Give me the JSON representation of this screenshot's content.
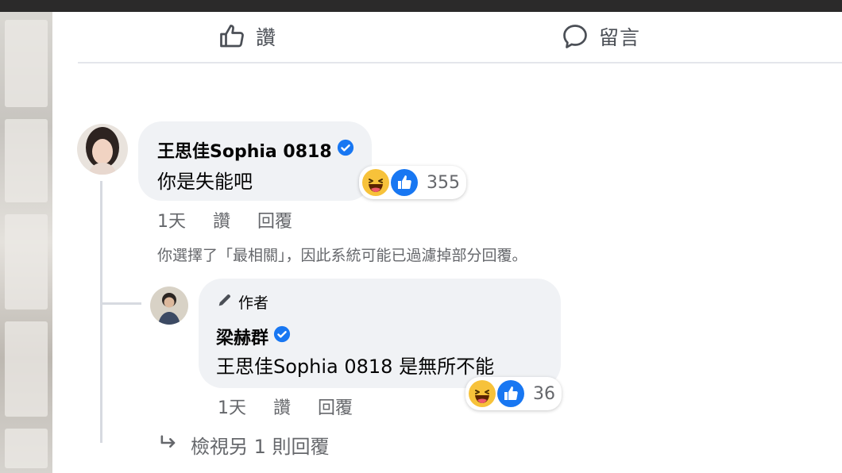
{
  "action_bar": {
    "like_label": "讚",
    "comment_label": "留言"
  },
  "comment": {
    "author": "王思佳Sophia 0818",
    "text": "你是失能吧",
    "reaction_count": "355",
    "time": "1天",
    "like_action": "讚",
    "reply_action": "回覆"
  },
  "filter_notice": "你選擇了「最相關」，因此系統可能已過濾掉部分回覆。",
  "reply": {
    "badge": "作者",
    "author": "梁赫群",
    "text": "王思佳Sophia 0818 是無所不能",
    "reaction_count": "36",
    "time": "1天",
    "like_action": "讚",
    "reply_action": "回覆"
  },
  "view_more": "檢視另 1 則回覆",
  "colors": {
    "facebook_blue": "#1877f2",
    "bubble_bg": "#f0f2f5",
    "secondary_text": "#65676b",
    "haha_yellow": "#f7c23a"
  },
  "icons": [
    "thumbs-up-icon",
    "comment-icon",
    "verified-badge-icon",
    "haha-reaction-icon",
    "like-reaction-icon",
    "pencil-icon",
    "reply-arrow-icon"
  ]
}
